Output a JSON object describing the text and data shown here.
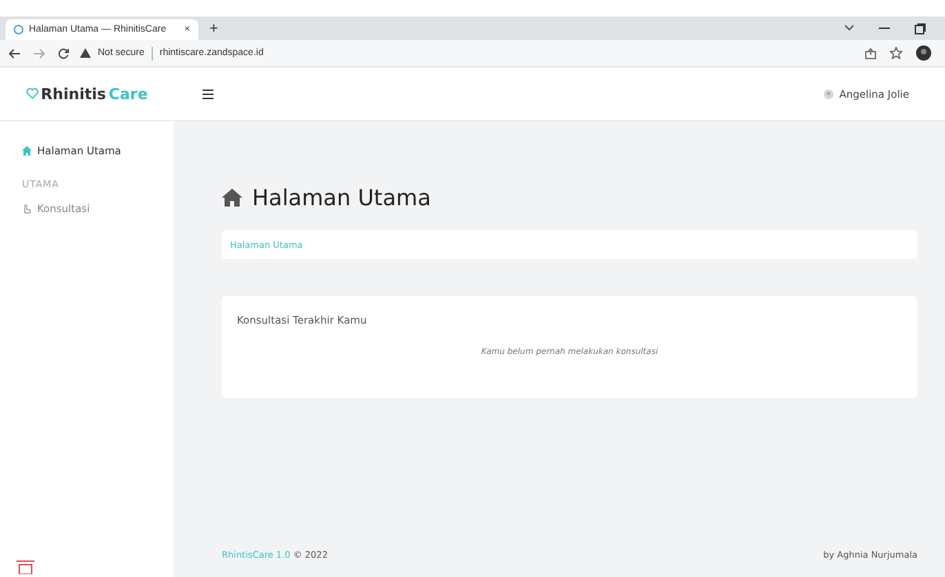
{
  "browser": {
    "tab_title": "Halaman Utama — RhinitisCare",
    "tab_close": "×",
    "new_tab": "+",
    "security": "Not secure",
    "url": "rhintiscare.zandspace.id"
  },
  "header": {
    "brand_prefix": "Rhinitis",
    "brand_suffix": "Care",
    "user": "Angelina Jolie"
  },
  "sidebar": [
    {
      "kind": "item",
      "label": "Halaman Utama",
      "selected": true
    },
    {
      "kind": "heading",
      "label": "UTAMA"
    },
    {
      "kind": "item",
      "label": "Konsultasi",
      "selected": false
    }
  ],
  "page_title": "Halaman Utama",
  "breadcrumb": "Halaman Utama",
  "card": {
    "title": "Konsultasi Terakhir Kamu",
    "empty_message": "Kamu belum pernah melakukan konsultasi"
  },
  "footer": {
    "brand": "RhintisCare 1.0",
    "copyright": "© 2022",
    "credit": "by Aghnia Nurjumala"
  }
}
